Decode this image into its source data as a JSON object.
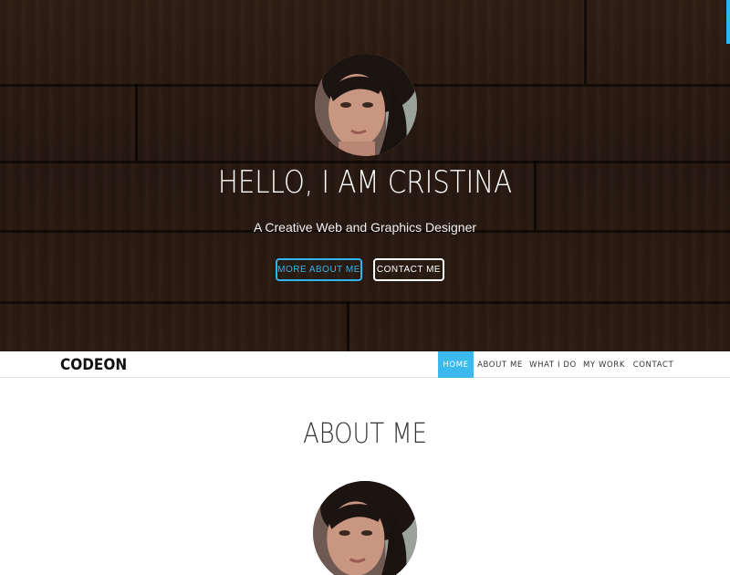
{
  "hero": {
    "title": "HELLO, I AM CRISTINA",
    "subtitle": "A Creative Web and Graphics Designer",
    "primary_button": "MORE ABOUT ME",
    "secondary_button": "CONTACT ME"
  },
  "navbar": {
    "brand": "CODEON",
    "items": [
      {
        "label": "HOME",
        "active": true
      },
      {
        "label": "ABOUT ME",
        "active": false
      },
      {
        "label": "WHAT I DO",
        "active": false
      },
      {
        "label": "MY WORK",
        "active": false
      },
      {
        "label": "CONTACT",
        "active": false
      }
    ]
  },
  "about": {
    "title": "ABOUT ME"
  },
  "colors": {
    "accent": "#3bb9ee",
    "hero_wood": "#2a1a11"
  }
}
